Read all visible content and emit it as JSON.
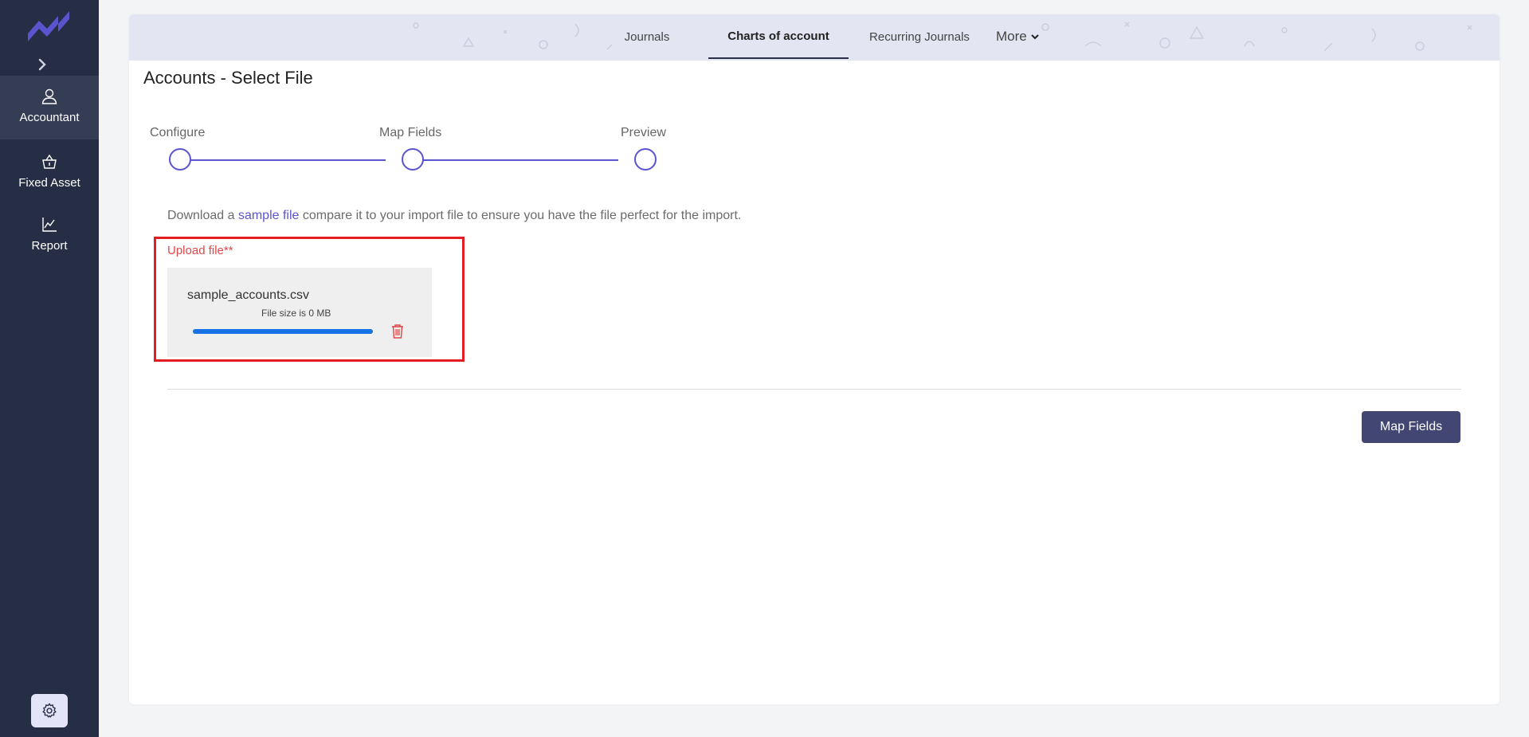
{
  "sidebar": {
    "items": [
      {
        "label": "Accountant",
        "icon": "user-icon",
        "active": true
      },
      {
        "label": "Fixed Asset",
        "icon": "basket-icon"
      },
      {
        "label": "Report",
        "icon": "chart-line-icon"
      }
    ],
    "settings_icon": "gear-icon"
  },
  "tabs": {
    "journals": "Journals",
    "charts": "Charts of account",
    "recurring": "Recurring Journals",
    "more": "More"
  },
  "page": {
    "title": "Accounts - Select File"
  },
  "stepper": {
    "steps": [
      "Configure",
      "Map Fields",
      "Preview"
    ]
  },
  "info": {
    "prefix": "Download a ",
    "link": "sample file",
    "suffix": " compare it to your import file to ensure you have the file perfect for the import."
  },
  "upload": {
    "label": "Upload file**",
    "file_name": "sample_accounts.csv",
    "file_size_text": "File size is 0 MB",
    "progress_percent": 100
  },
  "actions": {
    "map_fields": "Map Fields"
  },
  "colors": {
    "sidebar_bg": "#262e45",
    "accent": "#5b54cf",
    "danger": "#e31b23",
    "primary_button": "#424672",
    "progress": "#1673e6"
  }
}
